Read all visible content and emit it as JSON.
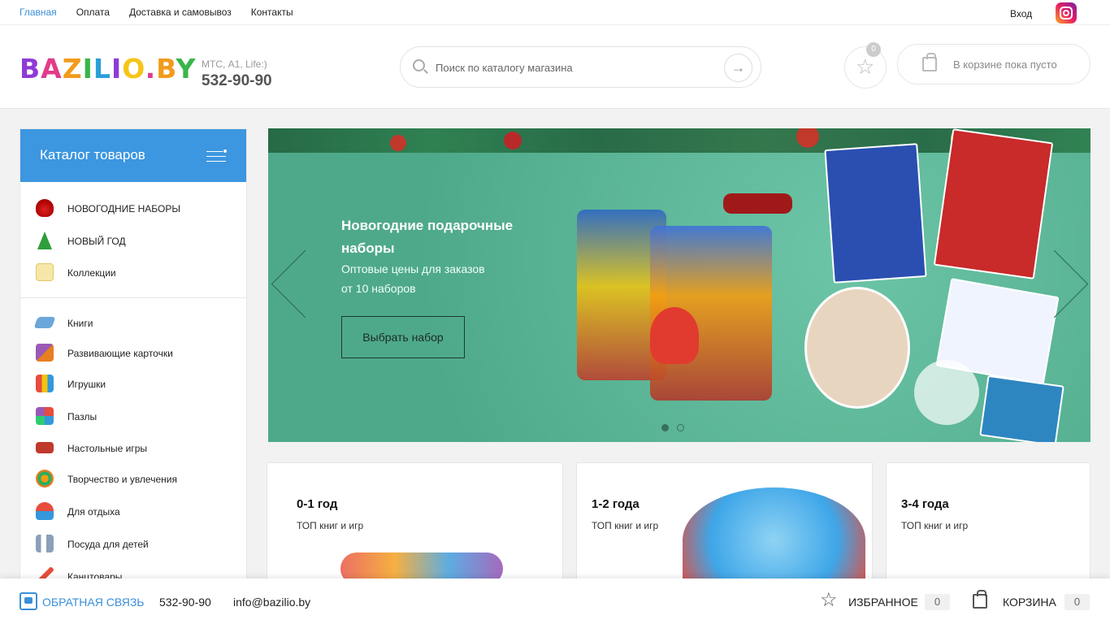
{
  "topnav": {
    "links": [
      "Главная",
      "Оплата",
      "Доставка и самовывоз",
      "Контакты"
    ],
    "login": "Вход"
  },
  "header": {
    "logo": "BAZILIO.BY",
    "phone_note": "МТС, А1, Life:)",
    "phone": "532-90-90",
    "search_placeholder": "Поиск по каталогу магазина",
    "fav_count": "0",
    "cart_text": "В корзине пока пусто"
  },
  "catalog": {
    "title": "Каталог товаров",
    "items": [
      {
        "label": "НОВОГОДНИЕ НАБОРЫ",
        "icon": "gift-bag-icon"
      },
      {
        "label": "НОВЫЙ ГОД",
        "icon": "christmas-tree-icon"
      },
      {
        "label": "Коллекции",
        "icon": "folder-icon"
      },
      {
        "label": "Книги",
        "icon": "book-icon"
      },
      {
        "label": "Развивающие карточки",
        "icon": "cards-icon"
      },
      {
        "label": "Игрушки",
        "icon": "blocks-icon"
      },
      {
        "label": "Пазлы",
        "icon": "puzzle-icon"
      },
      {
        "label": "Настольные игры",
        "icon": "board-game-icon"
      },
      {
        "label": "Творчество и увлечения",
        "icon": "palette-icon"
      },
      {
        "label": "Для отдыха",
        "icon": "beach-icon"
      },
      {
        "label": "Посуда для детей",
        "icon": "tableware-icon"
      },
      {
        "label": "Канцтовары",
        "icon": "pencil-icon"
      }
    ]
  },
  "banner": {
    "title": "Новогодние подарочные наборы",
    "subtitle": "Оптовые цены для заказов от 10 наборов",
    "button": "Выбрать набор",
    "slides": 2,
    "active_slide": 1
  },
  "age_cards": [
    {
      "title": "0-1 год",
      "subtitle": "ТОП книг и игр"
    },
    {
      "title": "1-2 года",
      "subtitle": "ТОП книг и игр"
    },
    {
      "title": "3-4 года",
      "subtitle": "ТОП книг и игр"
    }
  ],
  "bottombar": {
    "feedback": "ОБРАТНАЯ СВЯЗЬ",
    "phone": "532-90-90",
    "email": "info@bazilio.by",
    "fav_label": "ИЗБРАННОЕ",
    "fav_count": "0",
    "cart_label": "КОРЗИНА",
    "cart_count": "0"
  },
  "colors": {
    "accent": "#3c96e0",
    "banner_bg": "#52b394"
  }
}
